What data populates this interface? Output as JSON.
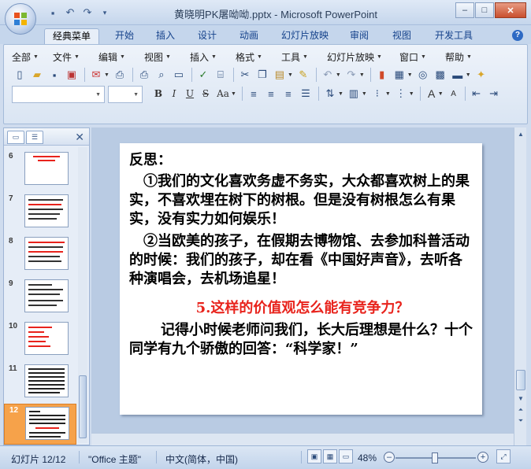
{
  "window": {
    "title": "黄晓明PK屠呦呦.pptx - Microsoft PowerPoint"
  },
  "ribbon_tabs": [
    "经典菜单",
    "开始",
    "插入",
    "设计",
    "动画",
    "幻灯片放映",
    "审阅",
    "视图",
    "开发工具"
  ],
  "menu": [
    "全部",
    "文件",
    "编辑",
    "视图",
    "插入",
    "格式",
    "工具",
    "幻灯片放映",
    "窗口",
    "帮助"
  ],
  "formatting": {
    "bold": "B",
    "italic": "I",
    "underline": "U",
    "strike": "S",
    "case": "Aa",
    "font_grow": "A",
    "font_shrink": "A"
  },
  "thumbnails": [
    {
      "num": "6"
    },
    {
      "num": "7"
    },
    {
      "num": "8"
    },
    {
      "num": "9"
    },
    {
      "num": "10"
    },
    {
      "num": "11"
    },
    {
      "num": "12"
    }
  ],
  "slide": {
    "heading": "反思：",
    "para1": "①我们的文化喜欢务虚不务实，大众都喜欢树上的果实，不喜欢埋在树下的树根。但是没有树根怎么有果实，没有实力如何娱乐！",
    "para2": "②当欧美的孩子，在假期去博物馆、去参加科普活动的时候：我们的孩子，却在看《中国好声音》，去听各种演唱会，去机场追星！",
    "question": "5.这样的价值观怎么能有竞争力？",
    "para3": "记得小时候老师问我们，长大后理想是什么？十个同学有九个骄傲的回答：“科学家！”"
  },
  "status": {
    "slide_counter": "幻灯片 12/12",
    "theme": "\"Office 主题\"",
    "language": "中文(简体，中国)",
    "zoom": "48%"
  },
  "colors": {
    "accent_red": "#e8231c",
    "selected_thumb": "#f6a24a"
  }
}
